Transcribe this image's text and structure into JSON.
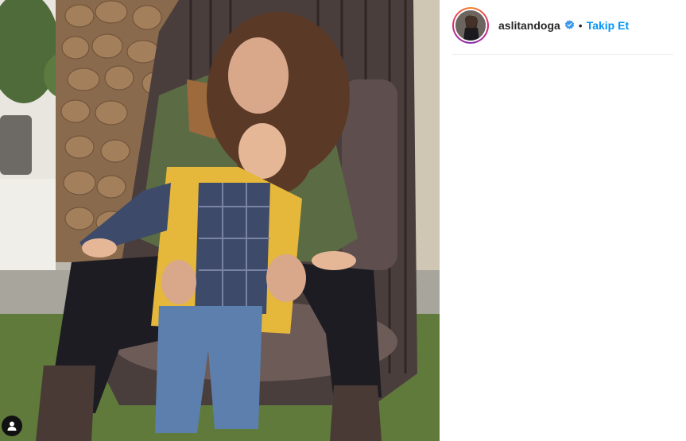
{
  "post": {
    "image_alt": "Woman kissing a smiling child on a woven cage chair",
    "tag_icon": "user-tag-icon"
  },
  "header": {
    "username": "aslitandoga",
    "verified_icon": "verified-badge-icon",
    "separator": "•",
    "follow_label": "Takip Et"
  },
  "colors": {
    "accent": "#0095f6",
    "verified": "#3897f0"
  }
}
